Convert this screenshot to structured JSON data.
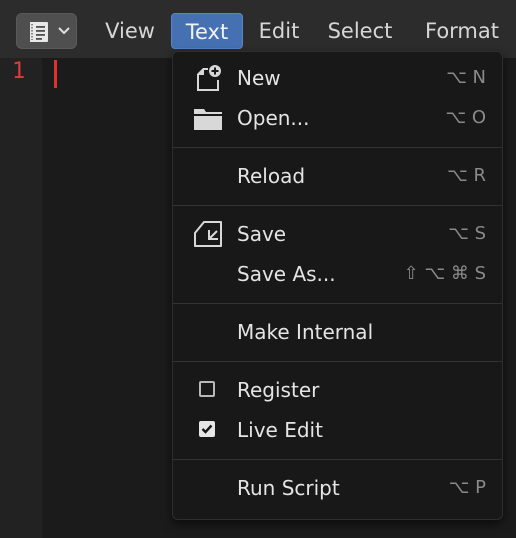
{
  "header": {
    "editor_type_icon": "text-editor-icon",
    "menus": [
      {
        "label": "View",
        "active": false
      },
      {
        "label": "Text",
        "active": true
      },
      {
        "label": "Edit",
        "active": false
      },
      {
        "label": "Select",
        "active": false
      },
      {
        "label": "Format",
        "active": false
      }
    ]
  },
  "editor": {
    "line_numbers": [
      "1"
    ]
  },
  "text_menu": {
    "items": [
      {
        "label": "New",
        "shortcut": "⌥ N",
        "icon": "new-file-icon"
      },
      {
        "label": "Open...",
        "shortcut": "⌥ O",
        "icon": "folder-icon"
      },
      {
        "label": "Reload",
        "shortcut": "⌥ R"
      },
      {
        "label": "Save",
        "shortcut": "⌥ S",
        "icon": "save-icon"
      },
      {
        "label": "Save As...",
        "shortcut": "⇧ ⌥ ⌘ S"
      },
      {
        "label": "Make Internal"
      },
      {
        "label": "Register",
        "checked": false
      },
      {
        "label": "Live Edit",
        "checked": true
      },
      {
        "label": "Run Script",
        "shortcut": "⌥ P"
      }
    ]
  },
  "colors": {
    "accent": "#4571b3",
    "line_number": "#e03a3a",
    "cursor": "#e0302f"
  }
}
